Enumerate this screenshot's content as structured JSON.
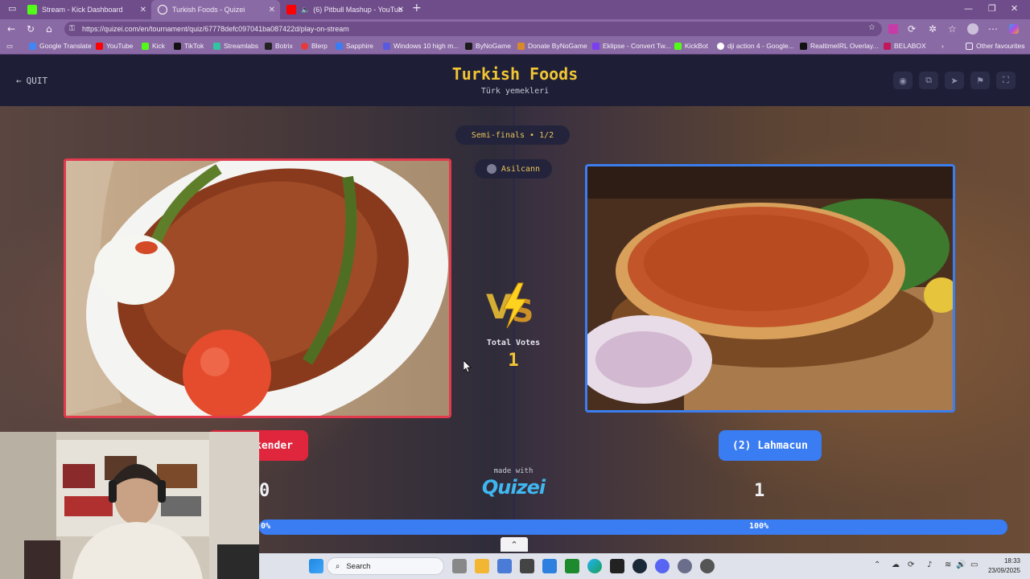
{
  "browser": {
    "tabs": [
      {
        "title": "Stream - Kick Dashboard",
        "color": "#53fc18"
      },
      {
        "title": "Turkish Foods - Quizei",
        "color": "#ffffff"
      },
      {
        "title": "(6) Pitbull Mashup - YouTub",
        "color": "#ff0000"
      }
    ],
    "url": "https://quizei.com/en/tournament/quiz/67778defc097041ba087422d/play-on-stream",
    "bookmarks": [
      {
        "label": "Google Translate",
        "color": "#4285f4"
      },
      {
        "label": "YouTube",
        "color": "#ff0000"
      },
      {
        "label": "Kick",
        "color": "#53fc18"
      },
      {
        "label": "TikTok",
        "color": "#111111"
      },
      {
        "label": "Streamlabs",
        "color": "#31c3a2"
      },
      {
        "label": "Botrix",
        "color": "#222222"
      },
      {
        "label": "Blerp",
        "color": "#e53a3a"
      },
      {
        "label": "Sapphire",
        "color": "#3a7cf2"
      },
      {
        "label": "Windows 10 high m...",
        "color": "#5a5adf"
      },
      {
        "label": "ByNoGame",
        "color": "#1a1a1a"
      },
      {
        "label": "Donate ByNoGame",
        "color": "#d88a2a"
      },
      {
        "label": "Eklipse - Convert Tw...",
        "color": "#7b3ff2"
      },
      {
        "label": "KickBot",
        "color": "#53fc18"
      },
      {
        "label": "dji action 4 - Google...",
        "color": "#ffffff"
      },
      {
        "label": "RealtimeIRL Overlay...",
        "color": "#111111"
      },
      {
        "label": "BELABOX",
        "color": "#c2185b"
      }
    ],
    "other_favourites": "Other favourites"
  },
  "header": {
    "quit": "QUIT",
    "title": "Turkish Foods",
    "subtitle": "Türk yemekleri"
  },
  "match": {
    "round": "Semi-finals • 1/2",
    "user": "Asilcann",
    "total_votes_label": "Total Votes",
    "total_votes": "1",
    "left": {
      "label": "kender",
      "votes": "0",
      "percent": "0%",
      "share": 0,
      "color": "#e0263d"
    },
    "right": {
      "label": "(2) Lahmacun",
      "votes": "1",
      "percent": "100%",
      "share": 1,
      "color": "#3a7cf2"
    },
    "made_with": "made with",
    "logo": "Quizei"
  },
  "taskbar": {
    "search": "Search",
    "time": "18:33",
    "date": "23/09/2025"
  }
}
